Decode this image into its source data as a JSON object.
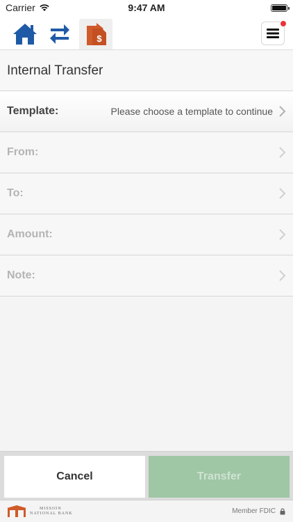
{
  "status_bar": {
    "carrier": "Carrier",
    "time": "9:47 AM"
  },
  "nav": {
    "items": [
      {
        "icon": "home-icon"
      },
      {
        "icon": "transfers-icon"
      },
      {
        "icon": "bill-pay-icon",
        "active": true
      }
    ],
    "menu_icon": "hamburger-menu-icon",
    "has_notification": true
  },
  "page": {
    "title": "Internal Transfer"
  },
  "form": {
    "template_label": "Template:",
    "template_value": "Please choose a template to continue",
    "from_label": "From:",
    "to_label": "To:",
    "amount_label": "Amount:",
    "note_label": "Note:"
  },
  "buttons": {
    "cancel": "Cancel",
    "transfer": "Transfer",
    "transfer_enabled": false
  },
  "footer": {
    "logo_line1": "MISSION",
    "logo_line2": "NATIONAL BANK",
    "fdic": "Member FDIC"
  },
  "colors": {
    "brand_blue": "#1f5aa6",
    "brand_orange": "#cf5a2a",
    "transfer_disabled": "#9fc6a5",
    "notification": "#e8353a"
  }
}
